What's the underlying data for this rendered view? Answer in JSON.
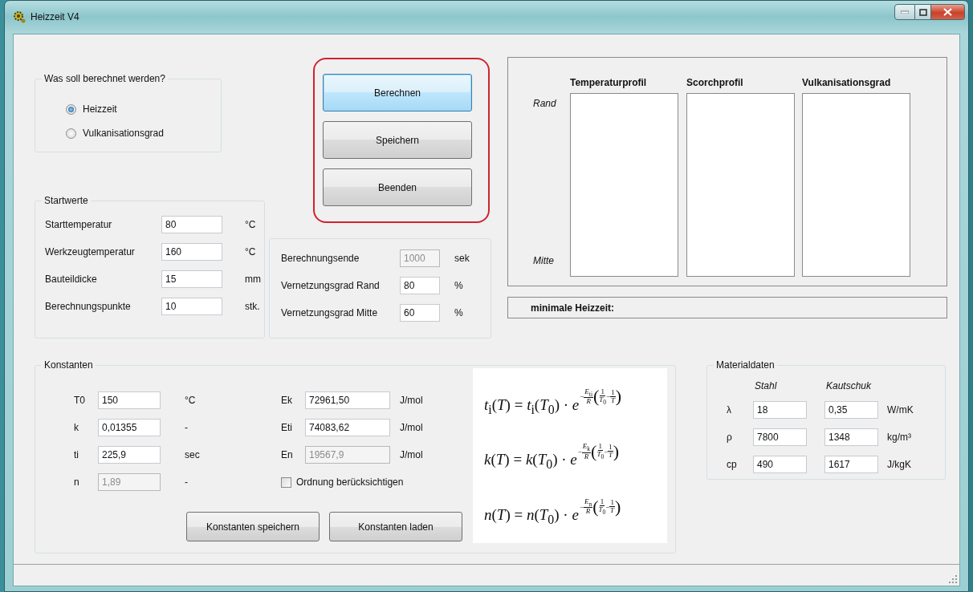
{
  "window": {
    "title": "Heizzeit V4"
  },
  "mode_group": {
    "title": "Was soll berechnet werden?",
    "options": [
      {
        "label": "Heizzeit",
        "selected": true
      },
      {
        "label": "Vulkanisationsgrad",
        "selected": false
      }
    ]
  },
  "actions": [
    {
      "label": "Berechnen",
      "focused": true
    },
    {
      "label": "Speichern",
      "focused": false
    },
    {
      "label": "Beenden",
      "focused": false
    }
  ],
  "startwerte": {
    "title": "Startwerte",
    "rows": [
      {
        "label": "Starttemperatur",
        "value": "80",
        "unit": "°C"
      },
      {
        "label": "Werkzeugtemperatur",
        "value": "160",
        "unit": "°C"
      },
      {
        "label": "Bauteildicke",
        "value": "15",
        "unit": "mm"
      },
      {
        "label": "Berechnungspunkte",
        "value": "10",
        "unit": "stk."
      }
    ]
  },
  "berechnung": {
    "rows": [
      {
        "label": "Berechnungsende",
        "value": "1000",
        "unit": "sek",
        "disabled": true
      },
      {
        "label": "Vernetzungsgrad Rand",
        "value": "80",
        "unit": "%",
        "disabled": false
      },
      {
        "label": "Vernetzungsgrad Mitte",
        "value": "60",
        "unit": "%",
        "disabled": false
      }
    ]
  },
  "profiles": {
    "row_labels": [
      "Rand",
      "Mitte"
    ],
    "columns": [
      "Temperaturprofil",
      "Scorchprofil",
      "Vulkanisationsgrad"
    ]
  },
  "result": {
    "label": "minimale Heizzeit:"
  },
  "konstanten": {
    "title": "Konstanten",
    "left_rows": [
      {
        "label": "T0",
        "value": "150",
        "unit": "°C",
        "disabled": false
      },
      {
        "label": "k",
        "value": "0,01355",
        "unit": "-",
        "disabled": false
      },
      {
        "label": "ti",
        "value": "225,9",
        "unit": "sec",
        "disabled": false
      },
      {
        "label": "n",
        "value": "1,89",
        "unit": "-",
        "disabled": true
      }
    ],
    "right_rows": [
      {
        "label": "Ek",
        "value": "72961,50",
        "unit": "J/mol",
        "disabled": false
      },
      {
        "label": "Eti",
        "value": "74083,62",
        "unit": "J/mol",
        "disabled": false
      },
      {
        "label": "En",
        "value": "19567,9",
        "unit": "J/mol",
        "disabled": true
      }
    ],
    "checkbox": {
      "label": "Ordnung berücksichtigen",
      "checked": false
    },
    "buttons": [
      "Konstanten speichern",
      "Konstanten laden"
    ]
  },
  "formulas": [
    {
      "lhs": "*t*$_{i}$(*T*) = *t*$_{i}$(*T*$_{0}$) · *e*",
      "exponent": {
        "coef_num": "*E*$_{ti}$",
        "coef_den": "*R*",
        "open": "(",
        "close": ")",
        "operator": "−",
        "sign": "−",
        "fractions": [
          {
            "num": "1",
            "den": "*T*$_{0}$"
          },
          {
            "num": "1",
            "den": "*T*"
          }
        ]
      }
    },
    {
      "lhs": "*k*(*T*) = *k*(*T*$_{0}$) · *e*",
      "exponent": {
        "coef_num": "*E*$_{k}$",
        "coef_den": "*R*",
        "open": "(",
        "close": ")",
        "operator": "−",
        "sign": "−",
        "fractions": [
          {
            "num": "1",
            "den": "*T*$_{0}$"
          },
          {
            "num": "1",
            "den": "*T*"
          }
        ]
      }
    },
    {
      "lhs": "*n*(*T*) = *n*(*T*$_{0}$) · *e*",
      "exponent": {
        "coef_num": "*E*$_{n}$",
        "coef_den": "*R*",
        "open": "(",
        "close": ")",
        "operator": "−",
        "sign": "−",
        "fractions": [
          {
            "num": "1",
            "den": "*T*$_{0}$"
          },
          {
            "num": "1",
            "den": "*T*"
          }
        ]
      }
    }
  ],
  "materialdaten": {
    "title": "Materialdaten",
    "columns": [
      "Stahl",
      "Kautschuk"
    ],
    "rows": [
      {
        "symbol": "λ",
        "values": [
          "18",
          "0,35"
        ],
        "unit": "W/mK"
      },
      {
        "symbol": "ρ",
        "values": [
          "7800",
          "1348"
        ],
        "unit": "kg/m³"
      },
      {
        "symbol": "cp",
        "values": [
          "490",
          "1617"
        ],
        "unit": "J/kgK"
      }
    ]
  }
}
